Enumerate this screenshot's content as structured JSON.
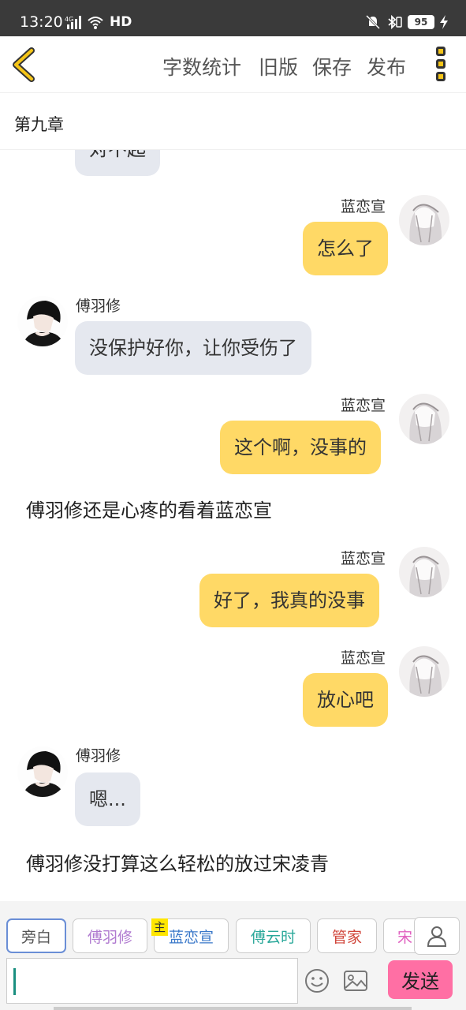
{
  "status_bar": {
    "time": "13:20",
    "network": "4G",
    "hd": "HD",
    "battery": "95"
  },
  "toolbar": {
    "word_count": "字数统计",
    "old_version": "旧版",
    "save": "保存",
    "publish": "发布"
  },
  "chapter_title": "第九章",
  "messages": [
    {
      "text": "对不起"
    },
    {
      "name": "蓝恋宣",
      "text": "怎么了"
    },
    {
      "name": "傅羽修",
      "text": "没保护好你，让你受伤了"
    },
    {
      "name": "蓝恋宣",
      "text": "这个啊，没事的"
    },
    {
      "narration": "傅羽修还是心疼的看着蓝恋宣"
    },
    {
      "name": "蓝恋宣",
      "text": "好了，我真的没事"
    },
    {
      "name": "蓝恋宣",
      "text": "放心吧"
    },
    {
      "name": "傅羽修",
      "text": "嗯..."
    },
    {
      "narration": "傅羽修没打算这么轻松的放过宋凌青"
    }
  ],
  "characters": [
    {
      "label": "旁白",
      "color": "#555555"
    },
    {
      "label": "傅羽修",
      "color": "#b07ad0"
    },
    {
      "label": "蓝恋宣",
      "color": "#3a78c9"
    },
    {
      "label": "傅云时",
      "color": "#2aa89a"
    },
    {
      "label": "管家",
      "color": "#d0453a"
    },
    {
      "label": "宋",
      "color": "#e060c0"
    }
  ],
  "main_tag": "主",
  "send_label": "发送",
  "colors": {
    "accent": "#f5c518",
    "bubble_right": "#ffd966",
    "bubble_left": "#e5e8ef",
    "send": "#ff6fa4"
  }
}
